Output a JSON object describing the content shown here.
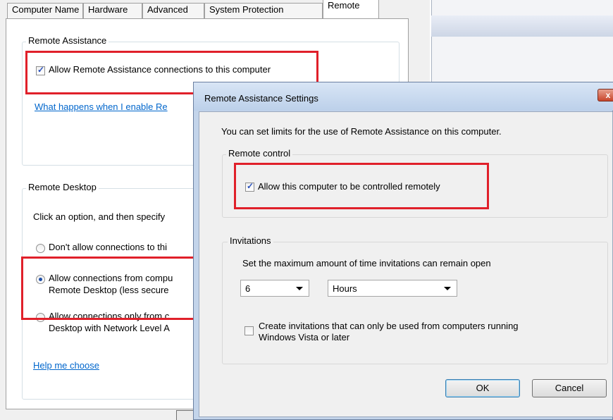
{
  "system_properties": {
    "tabs": [
      "Computer Name",
      "Hardware",
      "Advanced",
      "System Protection",
      "Remote"
    ],
    "remote_assistance": {
      "group_title": "Remote Assistance",
      "allow_checkbox_label": "Allow Remote Assistance connections to this computer",
      "allow_checked": true,
      "help_link": "What happens when I enable Re"
    },
    "remote_desktop": {
      "group_title": "Remote Desktop",
      "instruction": "Click an option, and then specify",
      "options": [
        {
          "line1": "Don't allow connections to thi",
          "line2": "",
          "selected": false
        },
        {
          "line1": "Allow connections from compu",
          "line2": "Remote Desktop (less secure",
          "selected": true
        },
        {
          "line1": "Allow connections only from c",
          "line2": "Desktop with Network Level A",
          "selected": false
        }
      ],
      "help_link": "Help me choose"
    }
  },
  "dialog": {
    "title": "Remote Assistance Settings",
    "close_label": "x",
    "intro": "You can set limits for the use of Remote Assistance on this computer.",
    "remote_control": {
      "group_title": "Remote control",
      "checkbox_label": "Allow this computer to be controlled remotely",
      "checked": true
    },
    "invitations": {
      "group_title": "Invitations",
      "instruction": "Set the maximum amount of time invitations can remain open",
      "amount_value": "6",
      "unit_value": "Hours",
      "vista_checkbox_line1": "Create invitations that can only be used from computers running",
      "vista_checkbox_line2": "Windows Vista or later",
      "vista_checked": false
    },
    "ok_label": "OK",
    "cancel_label": "Cancel"
  },
  "colors": {
    "highlight_box": "#e0202a",
    "link": "#0066cc",
    "check_accent": "#2a52be"
  }
}
